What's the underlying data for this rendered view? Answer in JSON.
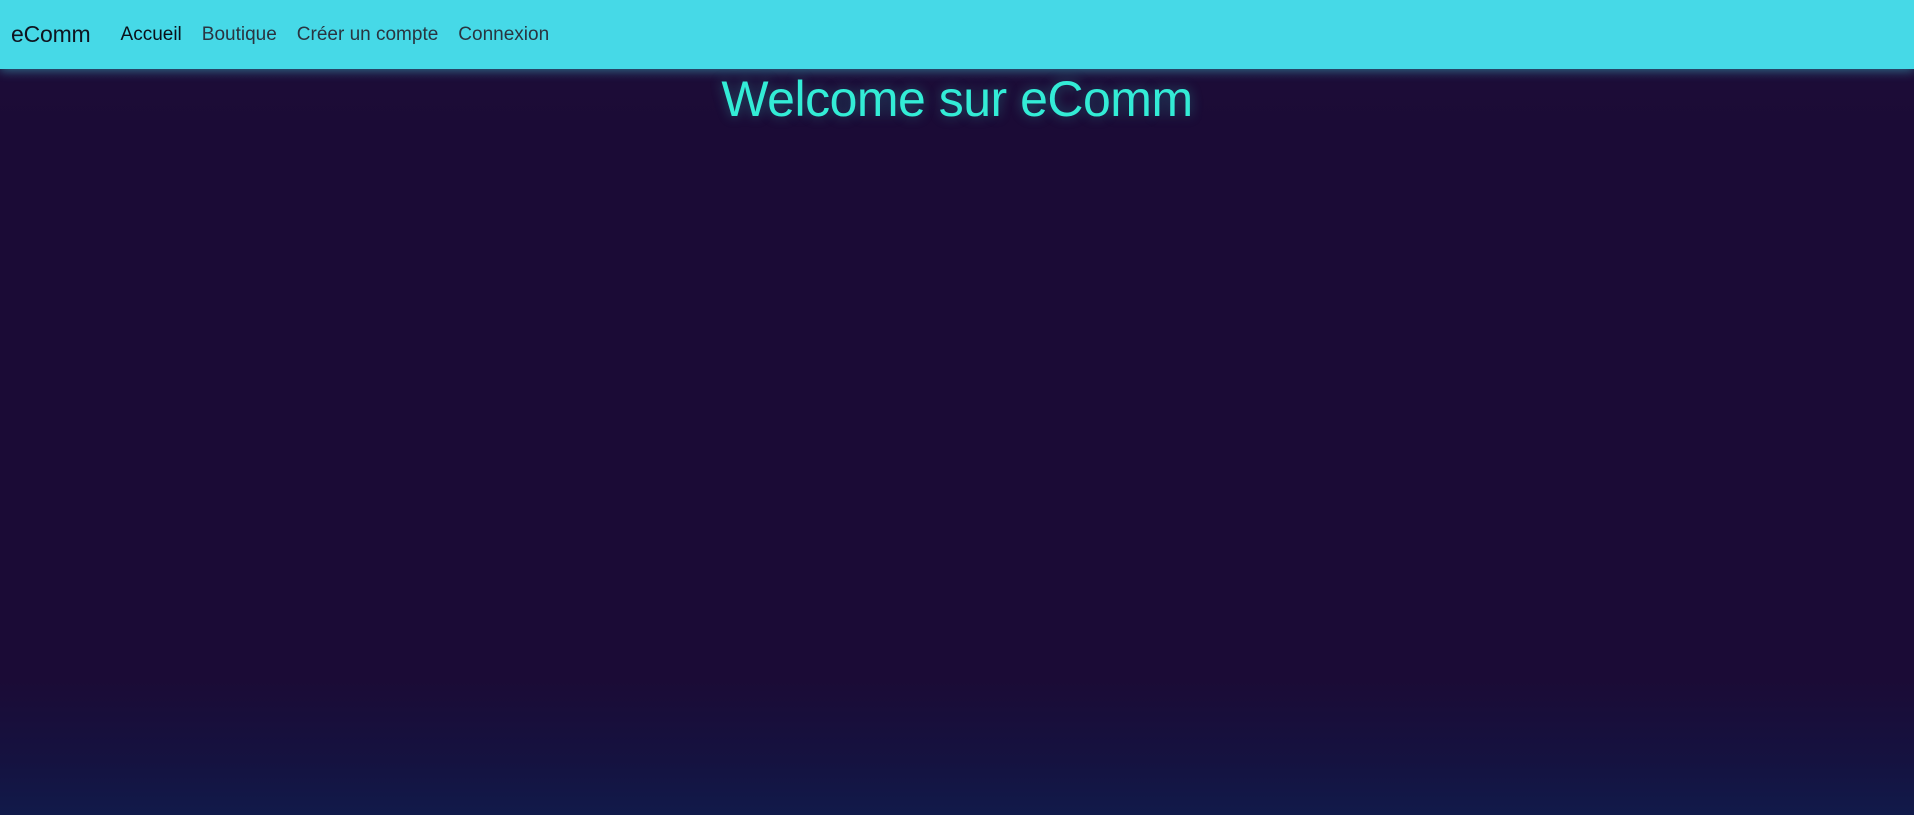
{
  "navbar": {
    "brand": "eComm",
    "links": [
      {
        "label": "Accueil",
        "active": true
      },
      {
        "label": "Boutique",
        "active": false
      },
      {
        "label": "Créer un compte",
        "active": false
      },
      {
        "label": "Connexion",
        "active": false
      }
    ],
    "background_color": "#46d9e7"
  },
  "main": {
    "title": "Welcome sur eComm",
    "title_color": "#33ecd6",
    "background_color": "#1b0b36"
  }
}
